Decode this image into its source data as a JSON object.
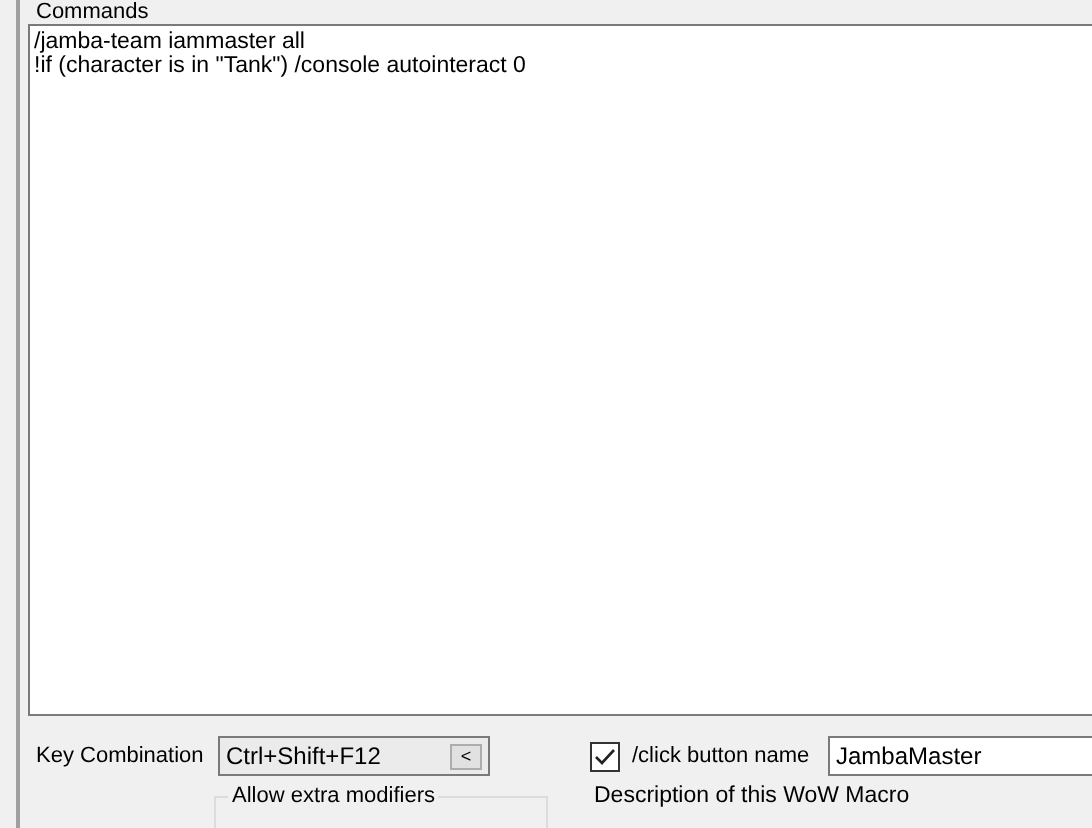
{
  "commands": {
    "label": "Commands",
    "lines": [
      "/jamba-team iammaster all",
      "!if (character is in \"Tank\") /console autointeract 0"
    ]
  },
  "key_combination": {
    "label": "Key Combination",
    "value": "Ctrl+Shift+F12",
    "clear_button": "<"
  },
  "click_button": {
    "checked": true,
    "label": "/click button name",
    "value": "JambaMaster"
  },
  "modifiers_group": {
    "title": "Allow extra modifiers"
  },
  "description": {
    "label": "Description of this WoW Macro"
  }
}
